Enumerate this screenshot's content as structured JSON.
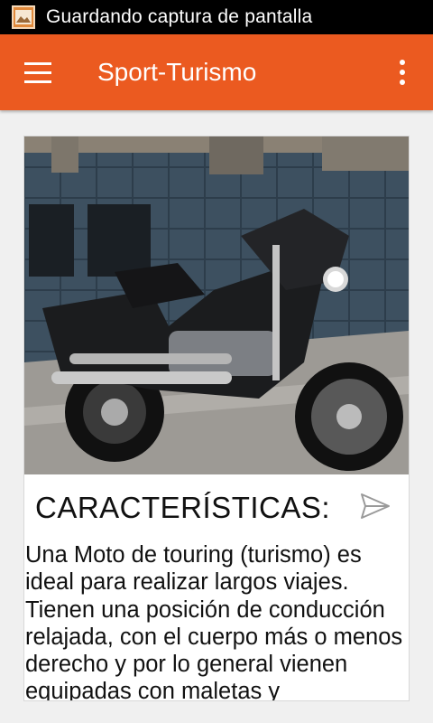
{
  "status_bar": {
    "notification": "Guardando captura de pantalla",
    "icon": "image-icon"
  },
  "app_bar": {
    "title": "Sport-Turismo",
    "menu_icon": "hamburger-menu-icon",
    "overflow_icon": "more-vertical-icon",
    "color": "#eb5a20"
  },
  "card": {
    "image_alt": "motorcycle-photo",
    "heading": "CARACTERÍSTICAS:",
    "share_icon": "send-icon",
    "body": "Una Moto de touring (turismo) es ideal para realizar largos viajes. Tienen una posición de conducción relajada, con el cuerpo más o menos derecho y por lo general vienen equipadas con maletas y"
  }
}
